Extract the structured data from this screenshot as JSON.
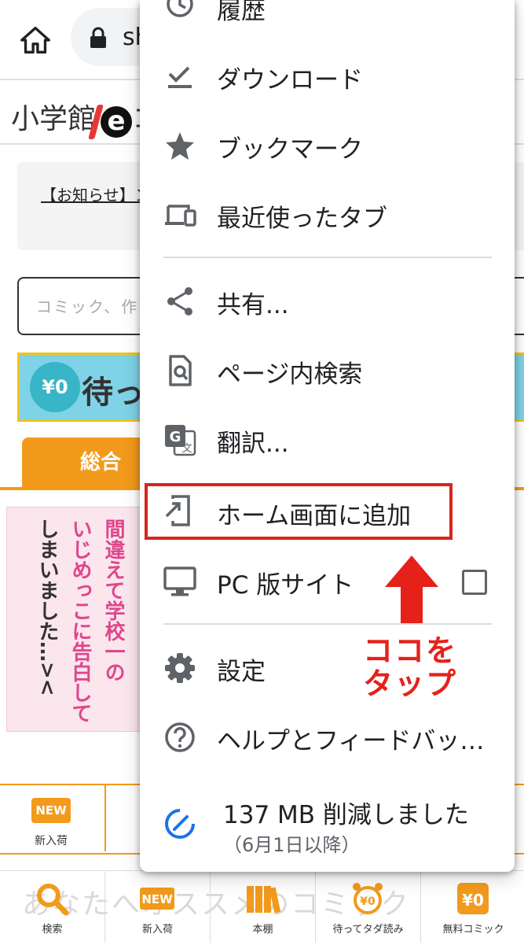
{
  "browser": {
    "url_partial": "sh"
  },
  "page": {
    "logo_text": "小学館",
    "logo_e": "e",
    "logo_tail": "コ",
    "notice": "【お知らせ】ン",
    "search_placeholder": "コミック、作",
    "banner_badge": "¥0",
    "banner_text": "待っ",
    "tab_general": "総合",
    "comic_lines": [
      "間違えて学校一の",
      "いじめっこに告白して",
      "しまいました…><"
    ],
    "category_badge": "NEW",
    "category_label": "新入荷",
    "faint_text": "あなたへオススメのコミック"
  },
  "bottom_nav": [
    {
      "label": "検索",
      "icon": "search-icon"
    },
    {
      "label": "新入荷",
      "icon": "new-badge-icon"
    },
    {
      "label": "本棚",
      "icon": "bookshelf-icon"
    },
    {
      "label": "待ってタダ読み",
      "icon": "alarm-clock-icon"
    },
    {
      "label": "無料コミック",
      "icon": "yen-zero-icon"
    }
  ],
  "menu": {
    "history": "履歴",
    "download": "ダウンロード",
    "bookmarks": "ブックマーク",
    "recent_tabs": "最近使ったタブ",
    "share": "共有...",
    "find_in_page": "ページ内検索",
    "translate": "翻訳...",
    "add_to_home": "ホーム画面に追加",
    "desktop_site": "PC 版サイト",
    "settings": "設定",
    "help": "ヘルプとフィードバッ…",
    "saved_main": "137 MB 削減しました",
    "saved_sub": "（6月1日以降）"
  },
  "annotation": {
    "line1": "ココを",
    "line2": "タップ"
  },
  "colors": {
    "accent_orange": "#f29a1c",
    "highlight_red": "#d7261c",
    "annotation_red": "#e5211a",
    "menu_icon_gray": "#5f6368",
    "data_saver_blue": "#1a73e8"
  }
}
